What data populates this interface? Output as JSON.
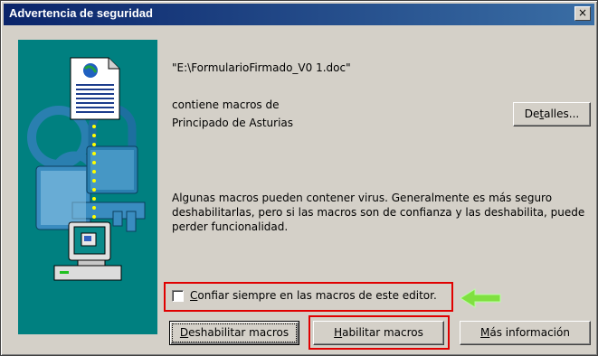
{
  "window": {
    "title": "Advertencia de seguridad",
    "close_glyph": "×"
  },
  "file": {
    "name": "\"E:\\FormularioFirmado_V0 1.doc\""
  },
  "macros": {
    "line1": "contiene macros de",
    "line2": "Principado de Asturias"
  },
  "buttons": {
    "details": {
      "pre": "De",
      "u": "t",
      "post": "alles..."
    },
    "disable": {
      "pre": "",
      "u": "D",
      "post": "eshabilitar macros"
    },
    "enable": {
      "pre": "",
      "u": "H",
      "post": "abilitar macros"
    },
    "more_info": {
      "pre": "",
      "u": "M",
      "post": "ás información"
    }
  },
  "warning": {
    "text": "Algunas macros pueden contener virus. Generalmente es más seguro deshabilitarlas, pero si las macros son de confianza y las deshabilita, puede perder funcionalidad."
  },
  "trust": {
    "u": "C",
    "rest": "onfiar siempre en las macros de este editor.",
    "checked": false
  },
  "colors": {
    "highlight": "#e00000",
    "arrow": "#80e040",
    "illustration_bg": "#008080",
    "title_bar": "#0a246a"
  }
}
